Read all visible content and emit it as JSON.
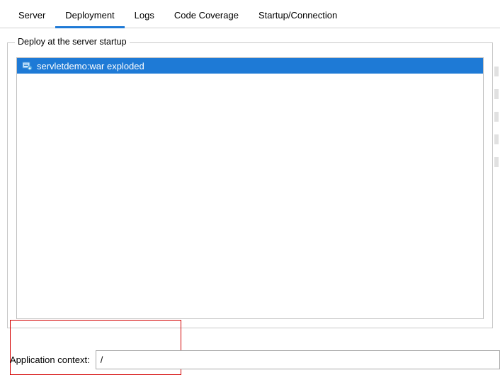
{
  "tabs": {
    "server": "Server",
    "deployment": "Deployment",
    "logs": "Logs",
    "coverage": "Code Coverage",
    "startup": "Startup/Connection"
  },
  "group": {
    "title": "Deploy at the server startup",
    "items": [
      {
        "label": "servletdemo:war exploded"
      }
    ]
  },
  "appContext": {
    "label": "Application context:",
    "value": "/"
  }
}
